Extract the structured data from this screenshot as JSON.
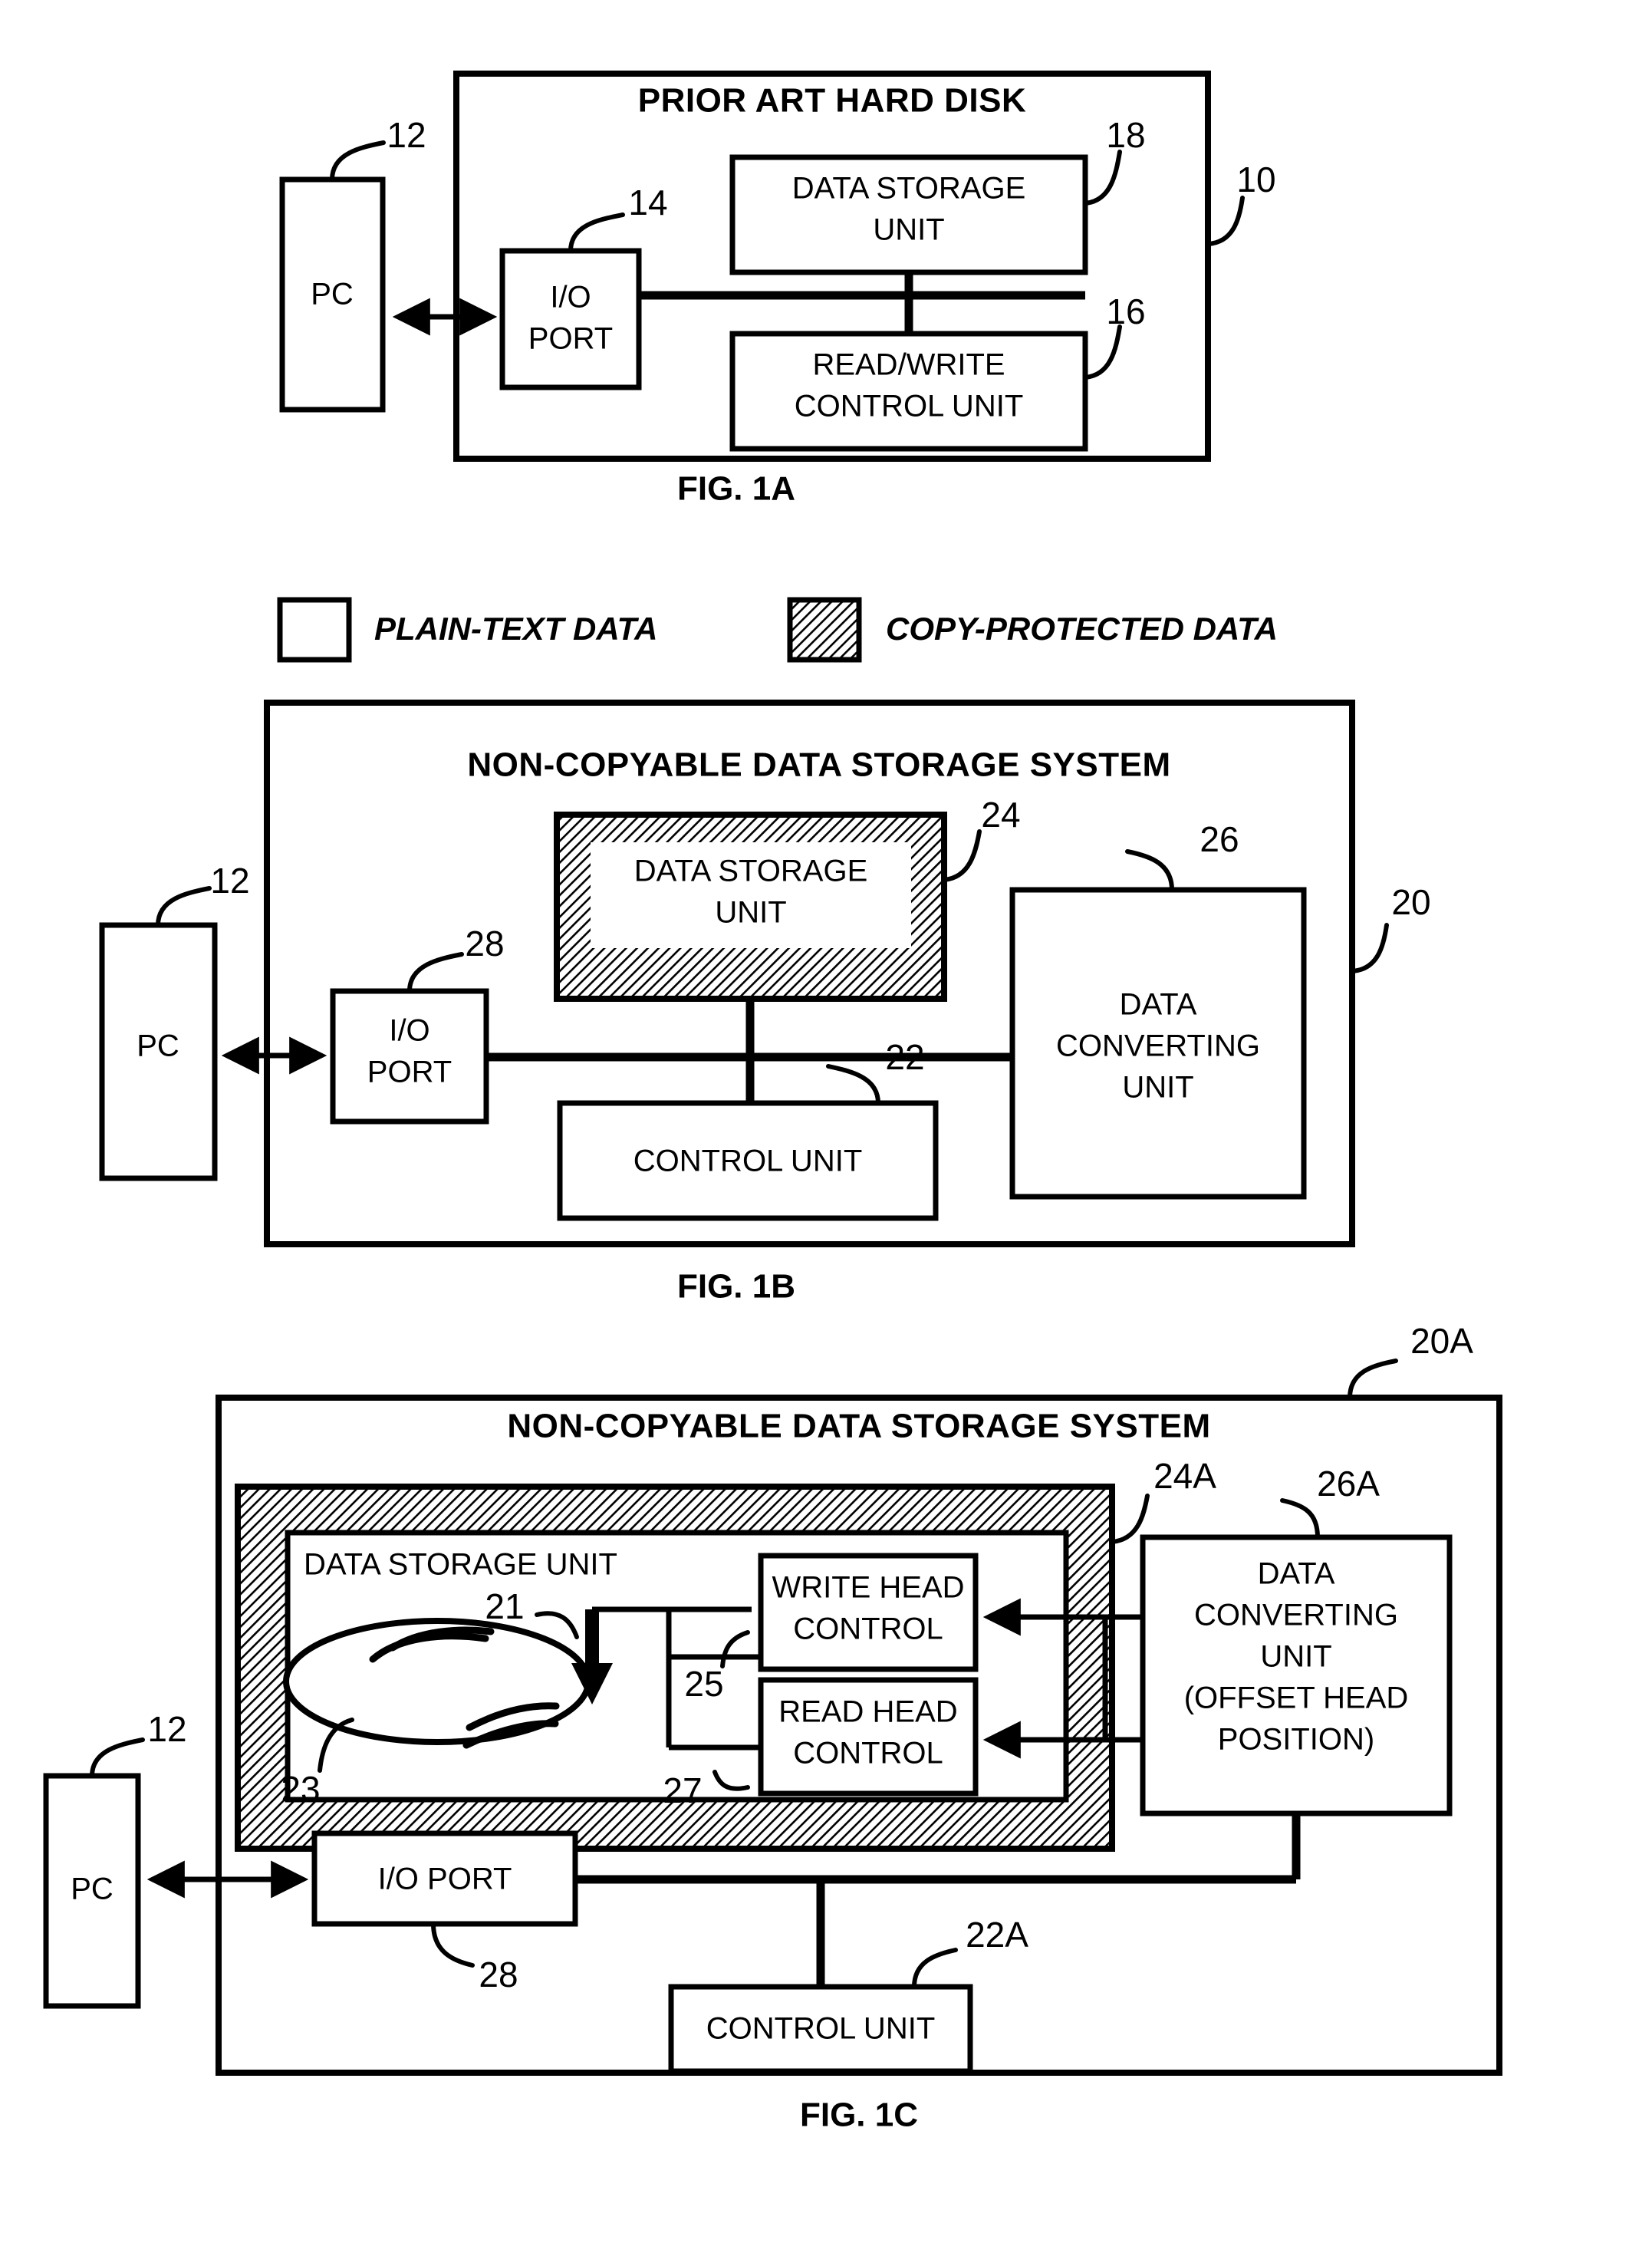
{
  "figures": [
    {
      "caption": "FIG. 1A",
      "title": "PRIOR ART HARD DISK",
      "system_ref": "10",
      "pc": {
        "label": "PC",
        "ref": "12"
      },
      "blocks": [
        {
          "label": "I/O PORT",
          "ref": "14"
        },
        {
          "label": "DATA STORAGE UNIT",
          "ref": "18"
        },
        {
          "label": "READ/WRITE CONTROL UNIT",
          "ref": "16"
        }
      ]
    },
    {
      "caption": "FIG. 1B",
      "title": "NON-COPYABLE DATA STORAGE SYSTEM",
      "system_ref": "20",
      "pc": {
        "label": "PC",
        "ref": "12"
      },
      "blocks": [
        {
          "label": "I/O PORT",
          "ref": "28"
        },
        {
          "label": "DATA STORAGE UNIT",
          "ref": "24"
        },
        {
          "label": "DATA CONVERTING UNIT",
          "ref": "26"
        },
        {
          "label": "CONTROL UNIT",
          "ref": "22"
        }
      ]
    },
    {
      "caption": "FIG. 1C",
      "title": "NON-COPYABLE DATA STORAGE SYSTEM",
      "system_ref": "20A",
      "pc": {
        "label": "PC",
        "ref": "12"
      },
      "blocks": [
        {
          "label": "DATA STORAGE UNIT",
          "ref": "24A"
        },
        {
          "label": "WRITE HEAD CONTROL",
          "ref": "25"
        },
        {
          "label": "READ HEAD CONTROL",
          "ref": "27"
        },
        {
          "label": "DATA CONVERTING UNIT (OFFSET HEAD POSITION)",
          "ref": "26A"
        },
        {
          "label": "I/O PORT",
          "ref": "28"
        },
        {
          "label": "CONTROL UNIT",
          "ref": "22A"
        }
      ],
      "disk": {
        "ref": "23",
        "head_arrow_ref": "21"
      }
    }
  ],
  "fig1a": {
    "title": "PRIOR ART HARD DISK",
    "pc_label": "PC",
    "io_port_line1": "I/O",
    "io_port_line2": "PORT",
    "storage_line1": "DATA STORAGE",
    "storage_line2": "UNIT",
    "rw_line1": "READ/WRITE",
    "rw_line2": "CONTROL UNIT",
    "ref_pc": "12",
    "ref_io": "14",
    "ref_storage": "18",
    "ref_rw": "16",
    "ref_system": "10",
    "caption": "FIG. 1A"
  },
  "legend": {
    "plain_text": "PLAIN-TEXT DATA",
    "copy_protected": "COPY-PROTECTED DATA"
  },
  "fig1b": {
    "title": "NON-COPYABLE DATA STORAGE SYSTEM",
    "pc_label": "PC",
    "io_port_line1": "I/O",
    "io_port_line2": "PORT",
    "storage_line1": "DATA STORAGE",
    "storage_line2": "UNIT",
    "converting_line1": "DATA",
    "converting_line2": "CONVERTING",
    "converting_line3": "UNIT",
    "control_label": "CONTROL UNIT",
    "ref_pc": "12",
    "ref_io": "28",
    "ref_storage": "24",
    "ref_converting": "26",
    "ref_control": "22",
    "ref_system": "20",
    "caption": "FIG. 1B"
  },
  "fig1c": {
    "title": "NON-COPYABLE DATA STORAGE SYSTEM",
    "pc_label": "PC",
    "storage_label": "DATA STORAGE UNIT",
    "write_head_line1": "WRITE HEAD",
    "write_head_line2": "CONTROL",
    "read_head_line1": "READ HEAD",
    "read_head_line2": "CONTROL",
    "converting_line1": "DATA",
    "converting_line2": "CONVERTING",
    "converting_line3": "UNIT",
    "converting_line4": "(OFFSET HEAD",
    "converting_line5": "POSITION)",
    "io_port_label": "I/O PORT",
    "control_label": "CONTROL UNIT",
    "ref_pc": "12",
    "ref_io": "28",
    "ref_storage": "24A",
    "ref_converting": "26A",
    "ref_control": "22A",
    "ref_system": "20A",
    "ref_head_arrow": "21",
    "ref_disk": "23",
    "ref_write_head": "25",
    "ref_read_head": "27",
    "caption": "FIG. 1C"
  },
  "colors": {
    "ink": "#000000",
    "paper": "#ffffff",
    "hatch": "#7d7d7d"
  }
}
